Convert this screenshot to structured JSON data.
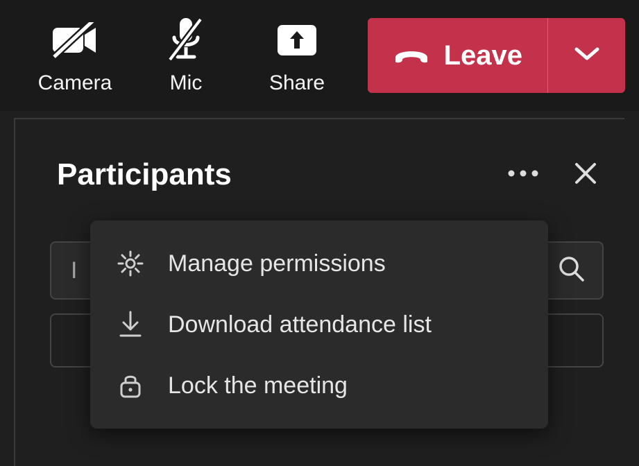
{
  "toolbar": {
    "camera_label": "Camera",
    "mic_label": "Mic",
    "share_label": "Share",
    "leave_label": "Leave"
  },
  "panel": {
    "title": "Participants",
    "invite_placeholder": "Invite someone",
    "invite_visible_text": "I"
  },
  "menu": {
    "items": [
      {
        "label": "Manage permissions"
      },
      {
        "label": "Download attendance list"
      },
      {
        "label": "Lock the meeting"
      }
    ]
  },
  "colors": {
    "leave_bg": "#c4314b"
  }
}
